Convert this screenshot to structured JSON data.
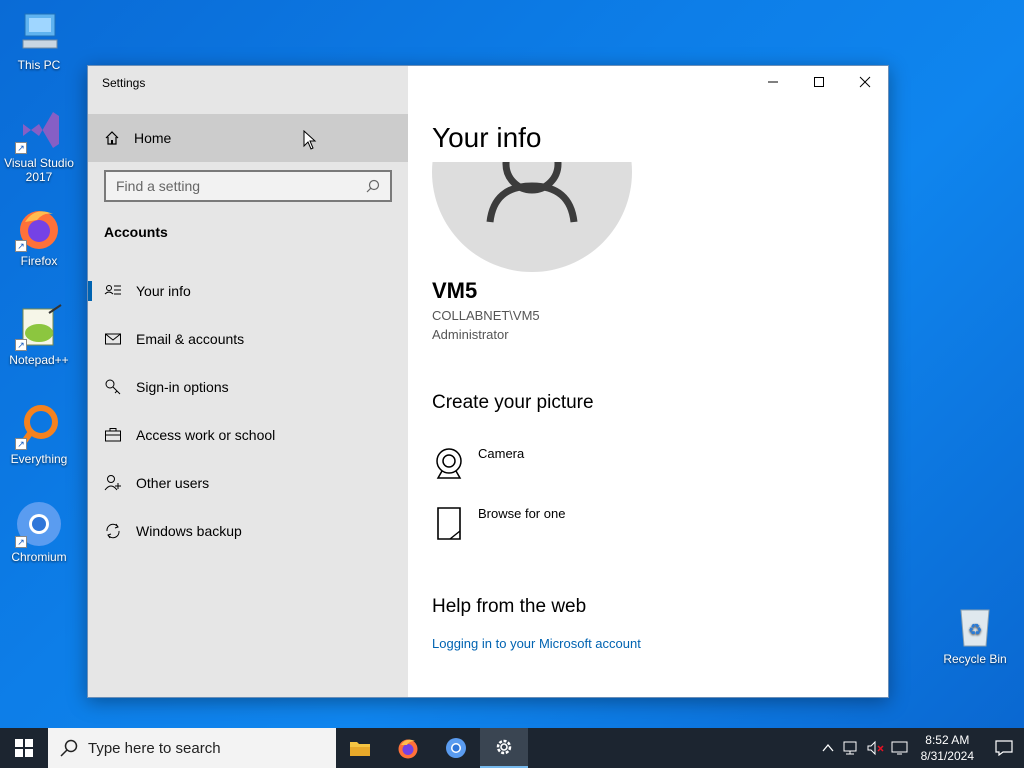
{
  "desktop": {
    "icons": [
      {
        "label": "This PC"
      },
      {
        "label": "Visual Studio 2017"
      },
      {
        "label": "Firefox"
      },
      {
        "label": "Notepad++"
      },
      {
        "label": "Everything"
      },
      {
        "label": "Chromium"
      },
      {
        "label": "Recycle Bin"
      }
    ]
  },
  "window": {
    "title": "Settings",
    "sidebar": {
      "home_label": "Home",
      "search_placeholder": "Find a setting",
      "section": "Accounts",
      "items": [
        {
          "label": "Your info",
          "icon": "person-list-icon",
          "active": true
        },
        {
          "label": "Email & accounts",
          "icon": "mail-icon"
        },
        {
          "label": "Sign-in options",
          "icon": "key-icon"
        },
        {
          "label": "Access work or school",
          "icon": "briefcase-icon"
        },
        {
          "label": "Other users",
          "icon": "person-add-icon"
        },
        {
          "label": "Windows backup",
          "icon": "sync-icon"
        }
      ]
    },
    "main": {
      "title": "Your info",
      "user_name": "VM5",
      "account": "COLLABNET\\VM5",
      "role": "Administrator",
      "create_picture_heading": "Create your picture",
      "camera_label": "Camera",
      "browse_label": "Browse for one",
      "help_heading": "Help from the web",
      "help_link": "Logging in to your Microsoft account"
    }
  },
  "taskbar": {
    "search_placeholder": "Type here to search",
    "time": "8:52 AM",
    "date": "8/31/2024"
  },
  "colors": {
    "accent": "#0063b1",
    "sidebar_bg": "#e6e6e6",
    "taskbar_bg": "#1c2530"
  }
}
